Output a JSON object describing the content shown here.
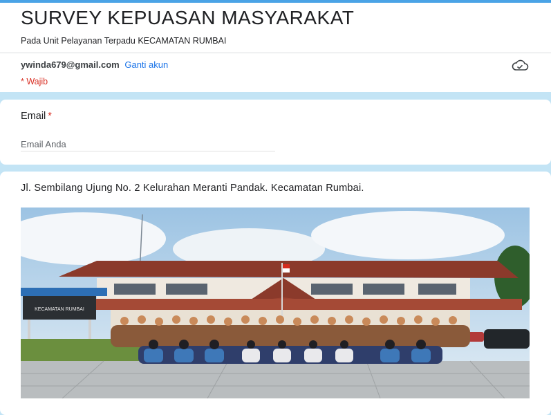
{
  "form": {
    "title": "SURVEY KEPUASAN MASYARAKAT",
    "subtitle": "Pada Unit Pelayanan Terpadu KECAMATAN RUMBAI",
    "account_email": "ywinda679@gmail.com",
    "switch_account_label": "Ganti akun",
    "required_note": "* Wajib",
    "cloud_icon": "cloud-saved-icon"
  },
  "email_question": {
    "label": "Email",
    "required_mark": "*",
    "placeholder": "Email Anda",
    "value": ""
  },
  "info_section": {
    "address": "Jl. Sembilang Ujung No. 2 Kelurahan Meranti Pandak. Kecamatan Rumbai.",
    "sign_title": "KECAMATAN RUMBAI"
  },
  "colors": {
    "accent": "#4aa3e6",
    "background": "#c3e4f5",
    "link": "#1a73e8",
    "required": "#d93025"
  }
}
